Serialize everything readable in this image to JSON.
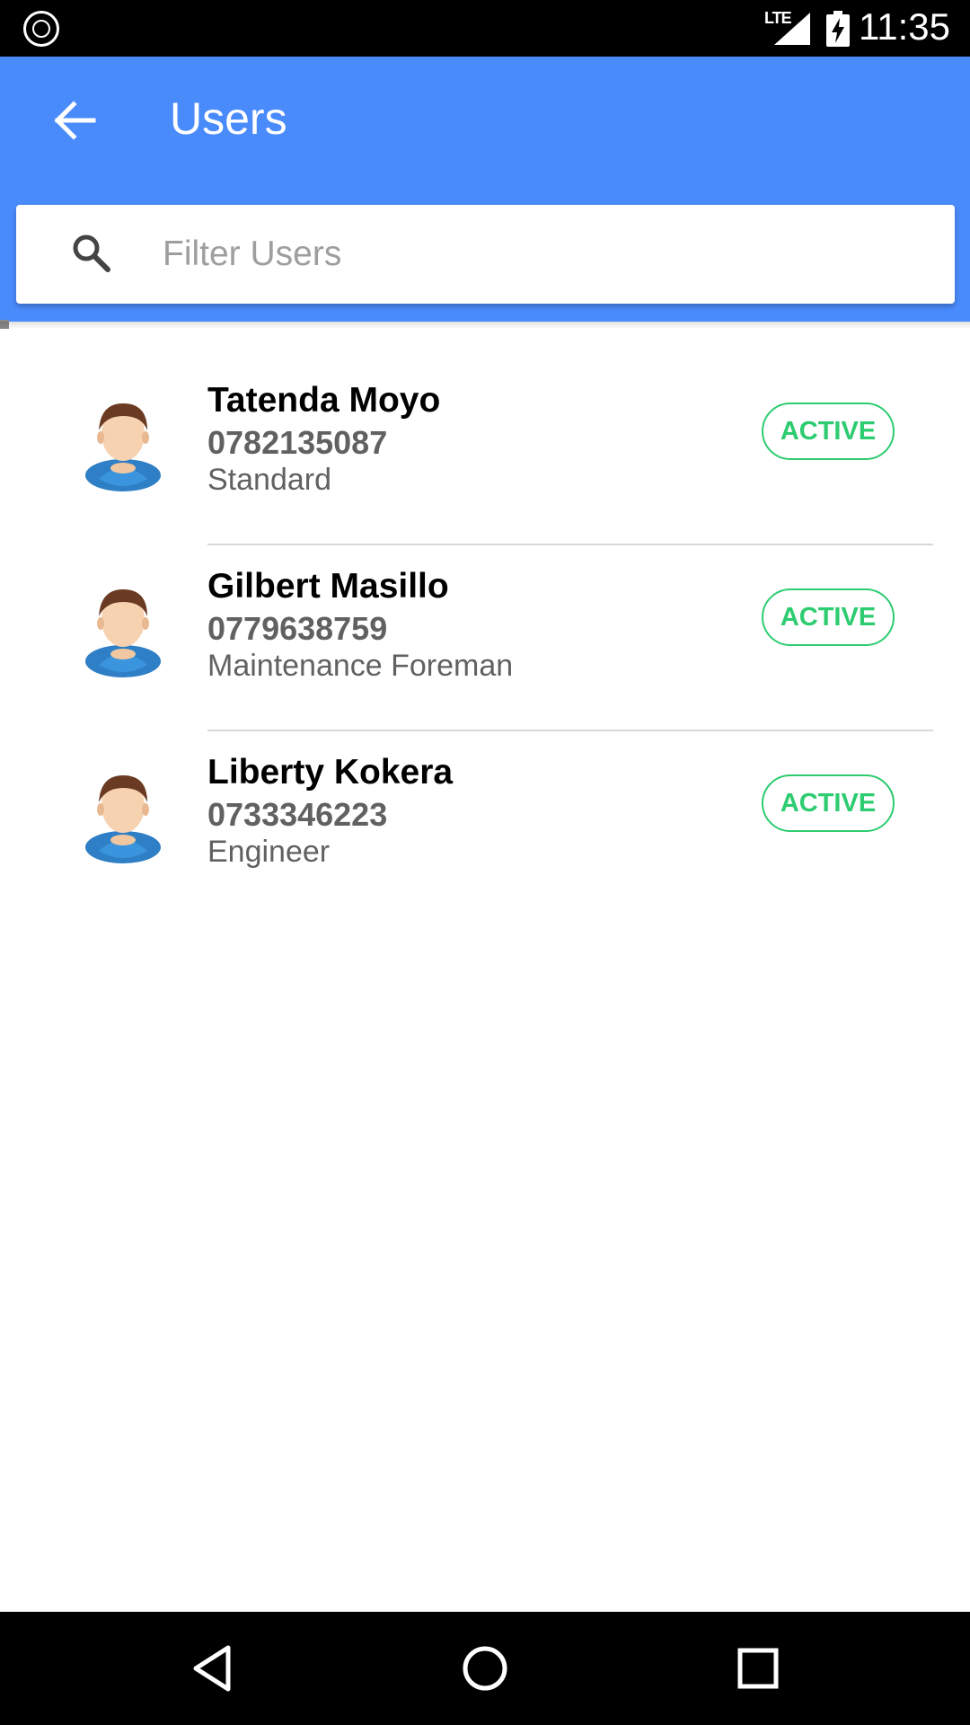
{
  "status_bar": {
    "network": "LTE",
    "time": "11:35"
  },
  "app_bar": {
    "title": "Users",
    "back_icon": "arrow-back-icon"
  },
  "search": {
    "placeholder": "Filter Users",
    "value": "",
    "icon": "search-icon"
  },
  "users": [
    {
      "name": "Tatenda Moyo",
      "phone": "0782135087",
      "role": "Standard",
      "status": "ACTIVE"
    },
    {
      "name": "Gilbert Masillo",
      "phone": "0779638759",
      "role": "Maintenance Foreman",
      "status": "ACTIVE"
    },
    {
      "name": "Liberty Kokera",
      "phone": "0733346223",
      "role": "Engineer",
      "status": "ACTIVE"
    }
  ],
  "nav_bar": {
    "back_icon": "triangle-back-icon",
    "home_icon": "circle-home-icon",
    "recents_icon": "square-recents-icon"
  },
  "colors": {
    "primary": "#4a8bfc",
    "status_active": "#2ecc71",
    "text_secondary": "#616161"
  }
}
